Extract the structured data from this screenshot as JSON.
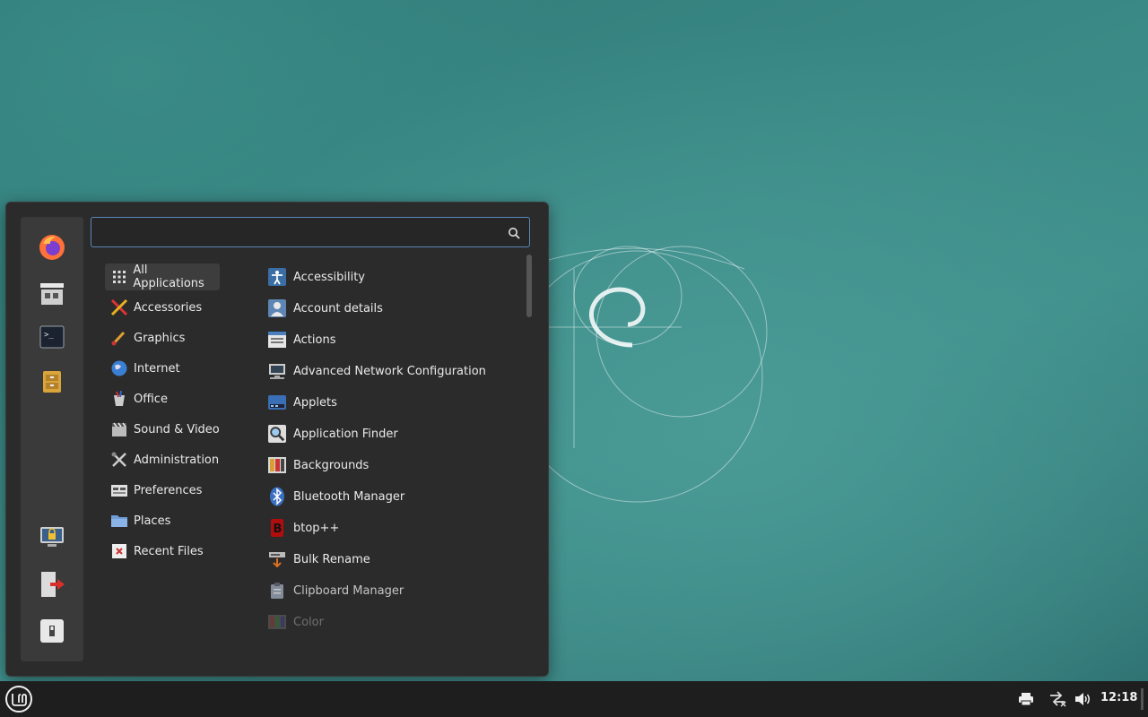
{
  "search": {
    "placeholder": "",
    "value": ""
  },
  "favorites": [
    {
      "name": "firefox-icon"
    },
    {
      "name": "software-store-icon"
    },
    {
      "name": "terminal-icon"
    },
    {
      "name": "file-manager-icon"
    }
  ],
  "session": [
    {
      "name": "lock-screen-icon"
    },
    {
      "name": "logout-icon"
    },
    {
      "name": "shutdown-icon"
    }
  ],
  "categories": [
    {
      "label": "All Applications",
      "icon": "grid-icon"
    },
    {
      "label": "Accessories",
      "icon": "accessories-icon"
    },
    {
      "label": "Graphics",
      "icon": "graphics-icon"
    },
    {
      "label": "Internet",
      "icon": "internet-icon"
    },
    {
      "label": "Office",
      "icon": "office-icon"
    },
    {
      "label": "Sound & Video",
      "icon": "sound-video-icon"
    },
    {
      "label": "Administration",
      "icon": "administration-icon"
    },
    {
      "label": "Preferences",
      "icon": "preferences-icon"
    },
    {
      "label": "Places",
      "icon": "folder-icon"
    },
    {
      "label": "Recent Files",
      "icon": "recent-files-icon"
    }
  ],
  "applications": [
    {
      "label": "Accessibility",
      "icon": "accessibility-icon"
    },
    {
      "label": "Account details",
      "icon": "account-icon"
    },
    {
      "label": "Actions",
      "icon": "actions-icon"
    },
    {
      "label": "Advanced Network Configuration",
      "icon": "network-icon"
    },
    {
      "label": "Applets",
      "icon": "applets-icon"
    },
    {
      "label": "Application Finder",
      "icon": "magnifier-icon"
    },
    {
      "label": "Backgrounds",
      "icon": "backgrounds-icon"
    },
    {
      "label": "Bluetooth Manager",
      "icon": "bluetooth-icon"
    },
    {
      "label": "btop++",
      "icon": "btop-icon"
    },
    {
      "label": "Bulk Rename",
      "icon": "bulk-rename-icon"
    },
    {
      "label": "Clipboard Manager",
      "icon": "clipboard-icon"
    },
    {
      "label": "Color",
      "icon": "color-icon"
    }
  ],
  "taskbar": {
    "clock": "12:18"
  },
  "colors": {
    "accent": "#5b87b8",
    "menu_bg": "#2b2b2b",
    "taskbar_bg": "#1e1e1e"
  }
}
